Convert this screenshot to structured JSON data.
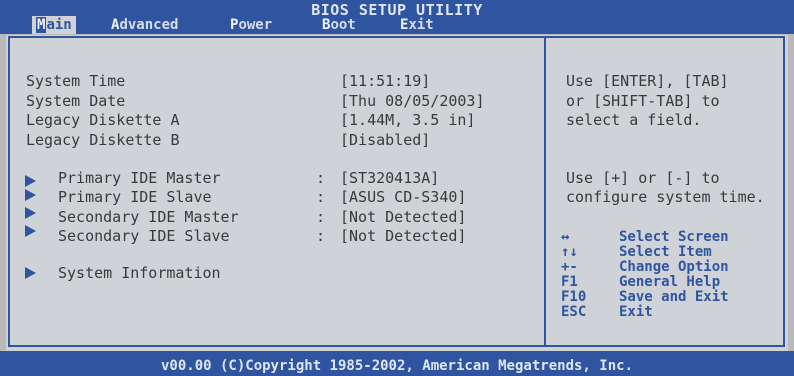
{
  "window": {
    "title": "BIOS SETUP UTILITY"
  },
  "tabs": [
    {
      "prefix": "M",
      "rest": "ain"
    },
    {
      "prefix": "A",
      "rest": "dvanced"
    },
    {
      "prefix": "P",
      "rest": "ower"
    },
    {
      "prefix": "B",
      "rest": "oot"
    },
    {
      "prefix": "E",
      "rest": "xit"
    }
  ],
  "main": {
    "settings": [
      {
        "label": "System Time",
        "value": "[11:51:19]"
      },
      {
        "label": "System Date",
        "value": "[Thu 08/05/2003]"
      },
      {
        "label": "Legacy Diskette A",
        "value": "[1.44M, 3.5 in]"
      },
      {
        "label": "Legacy Diskette B",
        "value": "[Disabled]"
      }
    ],
    "submenus": [
      {
        "label": "Primary IDE Master",
        "value": "[ST320413A]"
      },
      {
        "label": "Primary IDE Slave",
        "value": "[ASUS CD-S340]"
      },
      {
        "label": "Secondary IDE Master",
        "value": "[Not Detected]"
      },
      {
        "label": "Secondary IDE Slave",
        "value": "[Not Detected]"
      }
    ],
    "colon": ":",
    "system_info": "System Information"
  },
  "help": {
    "lines": [
      "Use [ENTER], [TAB]",
      "or [SHIFT-TAB] to",
      "select a field.",
      "Use [+] or [-] to",
      "configure system time."
    ],
    "keys": [
      {
        "key": "↔",
        "desc": "Select Screen"
      },
      {
        "key": "↑↓",
        "desc": "Select Item"
      },
      {
        "key": "+-",
        "desc": "Change Option"
      },
      {
        "key": "F1",
        "desc": "General Help"
      },
      {
        "key": "F10",
        "desc": "Save and Exit"
      },
      {
        "key": "ESC",
        "desc": "Exit"
      }
    ]
  },
  "footer": {
    "text": "v00.00 (C)Copyright 1985-2002, American Megatrends, Inc."
  },
  "colors": {
    "accent": "#2f55a0",
    "panel": "#cfd2d6"
  }
}
